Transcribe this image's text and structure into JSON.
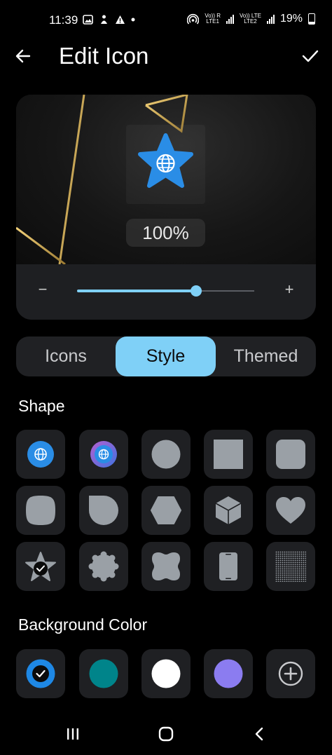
{
  "status_bar": {
    "time": "11:39",
    "sim1_top": "Vo)) R",
    "sim1_bottom": "LTE1",
    "sim2_top": "Vo)) LTE",
    "sim2_bottom": "LTE2",
    "battery_percent": "19%"
  },
  "header": {
    "title": "Edit Icon"
  },
  "preview": {
    "zoom_text": "100%",
    "slider_value_fraction": 0.67,
    "minus_label": "−",
    "plus_label": "+"
  },
  "tabs": [
    {
      "label": "Icons",
      "selected": false
    },
    {
      "label": "Style",
      "selected": true
    },
    {
      "label": "Themed",
      "selected": false
    }
  ],
  "shape_section": {
    "title": "Shape",
    "shapes": [
      "globe-circle-icon",
      "globe-gradient-circle-icon",
      "circle-shape",
      "square-shape",
      "rounded-square-shape",
      "squircle-shape",
      "teardrop-shape",
      "hexagon-shape",
      "cube-shape",
      "heart-shape",
      "star-shape-selected",
      "scalloped-shape",
      "clover-square-shape",
      "phone-shape",
      "dot-grid-shape"
    ],
    "selected_index": 10
  },
  "background_section": {
    "title": "Background Color",
    "colors": [
      "#1e88e5",
      "#00848a",
      "#ffffff",
      "#8b7cf0"
    ],
    "selected_index": 0,
    "add_icon": "add-circle-icon"
  },
  "colors": {
    "accent": "#7fd0f7",
    "shape_fill": "#9aa0a6",
    "tile_bg": "#1f2023",
    "star_blue": "#2a8de6"
  }
}
